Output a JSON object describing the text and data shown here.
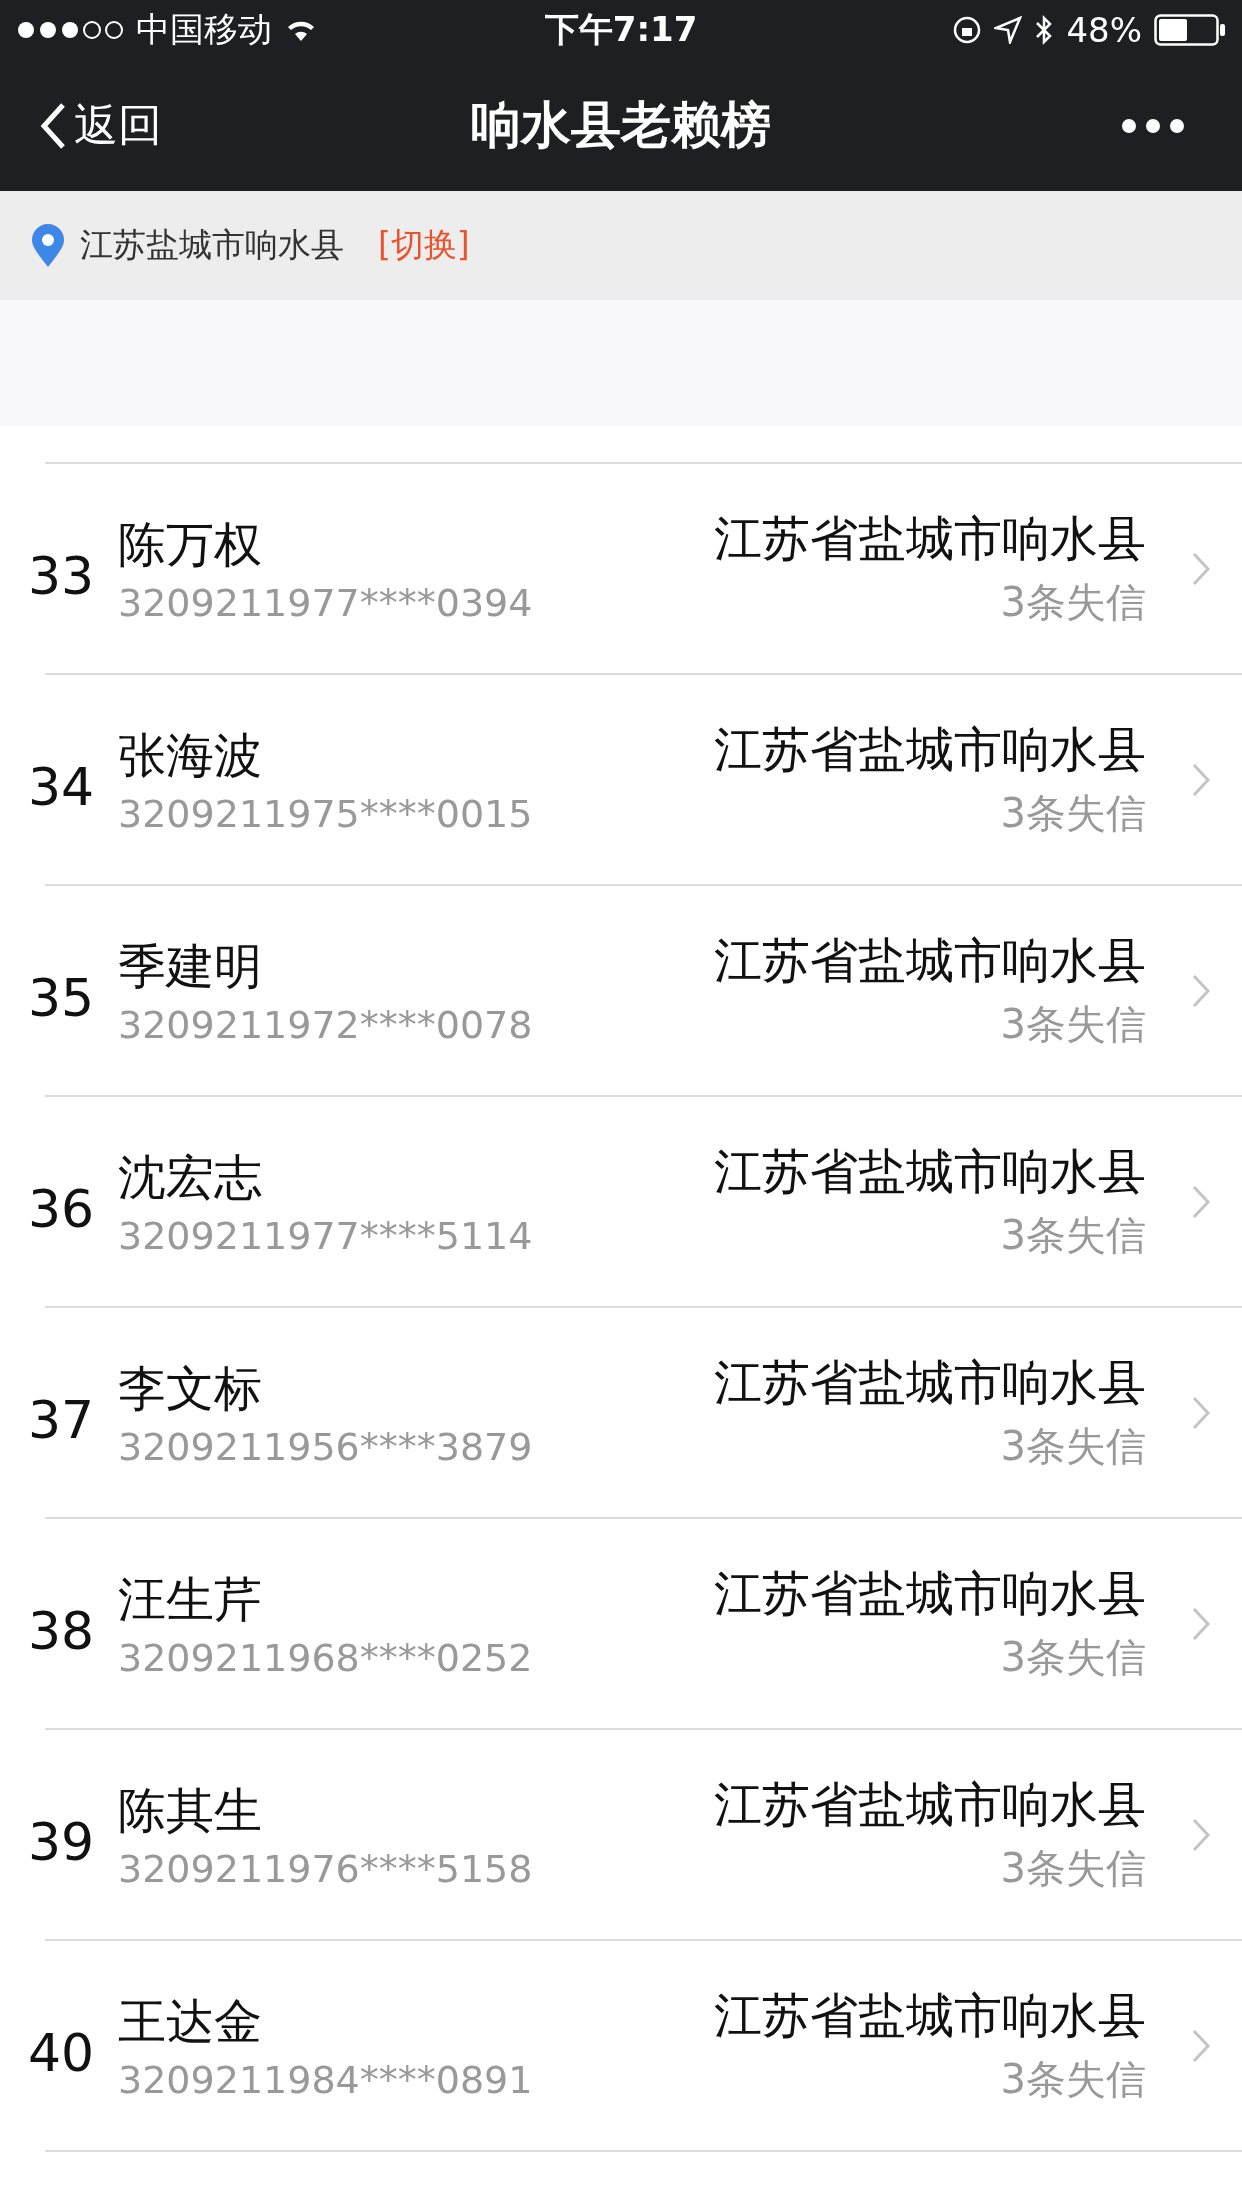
{
  "status_bar": {
    "carrier": "中国移动",
    "time": "下午7:17",
    "battery": "48%"
  },
  "nav": {
    "back": "返回",
    "title": "响水县老赖榜"
  },
  "location": {
    "text": "江苏盐城市响水县",
    "switch": "[切换]"
  },
  "rows": [
    {
      "rank": "33",
      "name": "陈万权",
      "id": "3209211977****0394",
      "address": "江苏省盐城市响水县",
      "count": "3条失信"
    },
    {
      "rank": "34",
      "name": "张海波",
      "id": "3209211975****0015",
      "address": "江苏省盐城市响水县",
      "count": "3条失信"
    },
    {
      "rank": "35",
      "name": "季建明",
      "id": "3209211972****0078",
      "address": "江苏省盐城市响水县",
      "count": "3条失信"
    },
    {
      "rank": "36",
      "name": "沈宏志",
      "id": "3209211977****5114",
      "address": "江苏省盐城市响水县",
      "count": "3条失信"
    },
    {
      "rank": "37",
      "name": "李文标",
      "id": "3209211956****3879",
      "address": "江苏省盐城市响水县",
      "count": "3条失信"
    },
    {
      "rank": "38",
      "name": "汪生芹",
      "id": "3209211968****0252",
      "address": "江苏省盐城市响水县",
      "count": "3条失信"
    },
    {
      "rank": "39",
      "name": "陈其生",
      "id": "3209211976****5158",
      "address": "江苏省盐城市响水县",
      "count": "3条失信"
    },
    {
      "rank": "40",
      "name": "王达金",
      "id": "3209211984****0891",
      "address": "江苏省盐城市响水县",
      "count": "3条失信"
    }
  ]
}
